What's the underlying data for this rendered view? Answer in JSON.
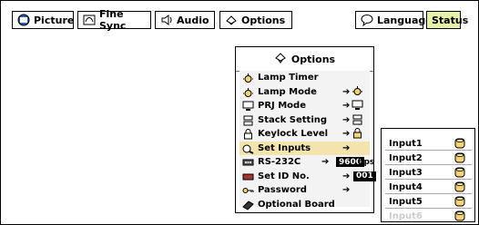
{
  "tabs": [
    {
      "label": "Picture",
      "icon": "picture-icon"
    },
    {
      "label": "Fine Sync",
      "icon": "fine-sync-icon"
    },
    {
      "label": "Audio",
      "icon": "speaker-icon"
    },
    {
      "label": "Options",
      "icon": "options-icon"
    },
    {
      "label": "Language",
      "icon": "speech-bubble-icon"
    },
    {
      "label": "Status",
      "icon": ""
    }
  ],
  "menu": {
    "title": "Options",
    "items": [
      {
        "label": "Lamp Timer",
        "icon": "lamp-timer-icon"
      },
      {
        "label": "Lamp Mode",
        "icon": "lamp-icon",
        "arrow": "➔"
      },
      {
        "label": "PRJ Mode",
        "icon": "projector-mode-icon",
        "arrow": "➔"
      },
      {
        "label": "Stack Setting",
        "icon": "stack-icon",
        "arrow": "➔"
      },
      {
        "label": "Keylock Level",
        "icon": "lock-icon",
        "arrow": "➔"
      },
      {
        "label": "Set Inputs",
        "icon": "set-inputs-icon",
        "arrow": "➔",
        "selected": true
      },
      {
        "label": "RS-232C",
        "icon": "rs232c-icon",
        "arrow": "➔",
        "value": "9600",
        "unit": "bps"
      },
      {
        "label": "Set ID No.",
        "icon": "id-icon",
        "arrow": "➔",
        "value": "001"
      },
      {
        "label": "Password",
        "icon": "key-icon",
        "arrow": "➔"
      },
      {
        "label": "Optional Board",
        "icon": "board-icon"
      }
    ]
  },
  "submenu": {
    "items": [
      {
        "label": "Input1"
      },
      {
        "label": "Input2"
      },
      {
        "label": "Input3"
      },
      {
        "label": "Input4"
      },
      {
        "label": "Input5"
      },
      {
        "label": "Input6",
        "disabled": true
      }
    ]
  },
  "colors": {
    "status_tab": "#e6f0a6",
    "selected_row": "#f3e4ad",
    "cylinder": "#f5d372"
  }
}
